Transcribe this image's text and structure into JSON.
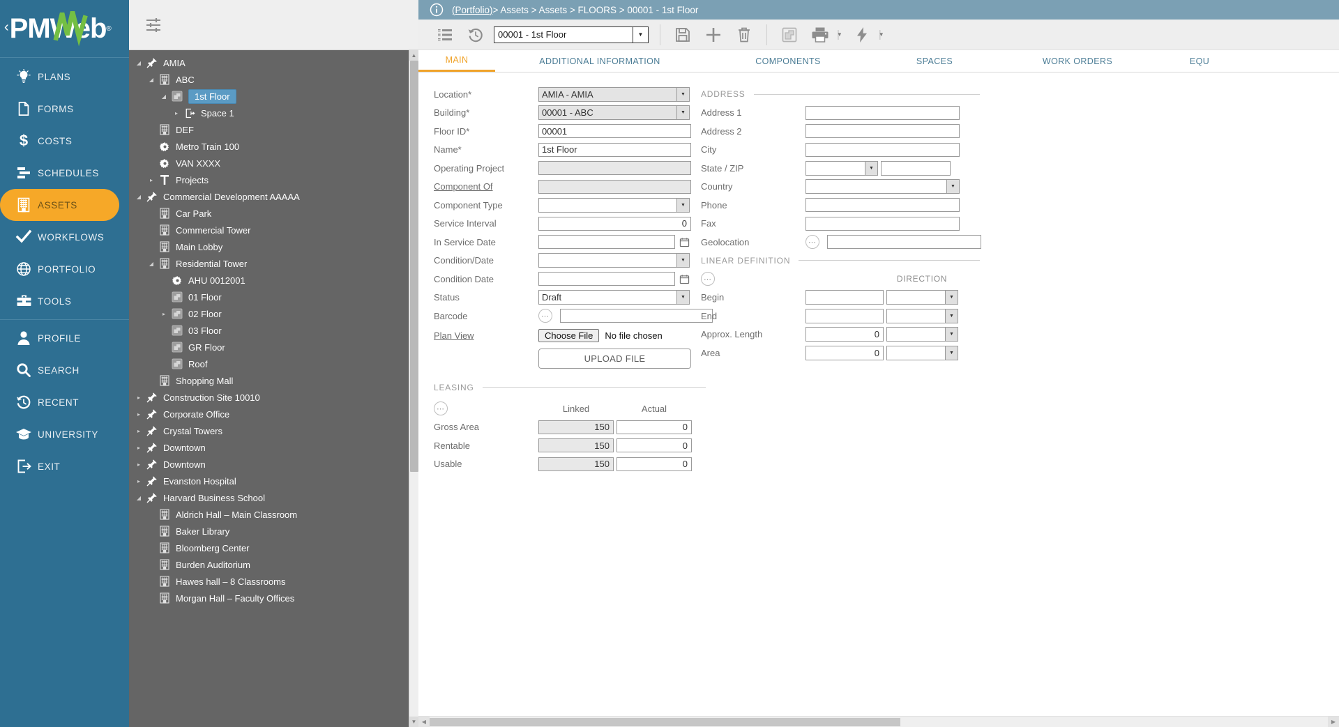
{
  "brand": {
    "logo_text": "PMWeb",
    "chevron": "‹",
    "registered": "®",
    "accent_color": "#f6a828",
    "nav_bg": "#2e6f92"
  },
  "sidebar": {
    "items": [
      {
        "label": "PLANS",
        "icon": "lightbulb-icon",
        "active": false
      },
      {
        "label": "FORMS",
        "icon": "document-icon",
        "active": false
      },
      {
        "label": "COSTS",
        "icon": "dollar-icon",
        "active": false
      },
      {
        "label": "SCHEDULES",
        "icon": "gantt-icon",
        "active": false
      },
      {
        "label": "ASSETS",
        "icon": "building-icon",
        "active": true
      },
      {
        "label": "WORKFLOWS",
        "icon": "check-icon",
        "active": false
      },
      {
        "label": "PORTFOLIO",
        "icon": "globe-icon",
        "active": false
      },
      {
        "label": "TOOLS",
        "icon": "toolbox-icon",
        "active": false
      }
    ],
    "items2": [
      {
        "label": "PROFILE",
        "icon": "user-icon"
      },
      {
        "label": "SEARCH",
        "icon": "magnifier-icon"
      },
      {
        "label": "RECENT",
        "icon": "history-icon"
      },
      {
        "label": "UNIVERSITY",
        "icon": "graduation-icon"
      },
      {
        "label": "EXIT",
        "icon": "exit-icon"
      }
    ]
  },
  "breadcrumb": {
    "info_icon": "info-icon",
    "portfolio": "(Portfolio)",
    "trail": " > Assets > Assets > FLOORS > 00001 - 1st Floor"
  },
  "toolbar": {
    "list_icon": "list-icon",
    "history_icon": "history-icon",
    "record_value": "00001 - 1st Floor",
    "save_icon": "save-icon",
    "add_icon": "plus-icon",
    "delete_icon": "trash-icon",
    "plan_icon": "floorplan-icon",
    "print_icon": "print-icon",
    "actions_icon": "lightning-icon"
  },
  "tree": {
    "filter_icon": "filter-icon",
    "nodes": [
      {
        "label": "AMIA",
        "indent": 0,
        "icon": "pin-icon",
        "twisty": "down",
        "selected": false
      },
      {
        "label": "ABC",
        "indent": 1,
        "icon": "building-icon",
        "twisty": "down",
        "selected": false
      },
      {
        "label": "1st Floor",
        "indent": 2,
        "icon": "floorplan-icon",
        "twisty": "down",
        "selected": true
      },
      {
        "label": "Space 1",
        "indent": 3,
        "icon": "space-icon",
        "twisty": "right",
        "selected": false
      },
      {
        "label": "DEF",
        "indent": 1,
        "icon": "building-icon",
        "twisty": "none",
        "selected": false
      },
      {
        "label": "Metro Train 100",
        "indent": 1,
        "icon": "gear-icon",
        "twisty": "none",
        "selected": false
      },
      {
        "label": "VAN XXXX",
        "indent": 1,
        "icon": "gear-icon",
        "twisty": "none",
        "selected": false
      },
      {
        "label": "Projects",
        "indent": 1,
        "icon": "tool-icon",
        "twisty": "right",
        "selected": false
      },
      {
        "label": "Commercial Development AAAAA",
        "indent": 0,
        "icon": "pin-icon",
        "twisty": "down",
        "selected": false
      },
      {
        "label": "Car Park",
        "indent": 1,
        "icon": "building-icon",
        "twisty": "none",
        "selected": false
      },
      {
        "label": "Commercial Tower",
        "indent": 1,
        "icon": "building-icon",
        "twisty": "none",
        "selected": false
      },
      {
        "label": "Main Lobby",
        "indent": 1,
        "icon": "building-icon",
        "twisty": "none",
        "selected": false
      },
      {
        "label": "Residential Tower",
        "indent": 1,
        "icon": "building-icon",
        "twisty": "down",
        "selected": false
      },
      {
        "label": "AHU 0012001",
        "indent": 2,
        "icon": "gear-icon",
        "twisty": "none",
        "selected": false
      },
      {
        "label": "01 Floor",
        "indent": 2,
        "icon": "floorplan-icon",
        "twisty": "none",
        "selected": false
      },
      {
        "label": "02 Floor",
        "indent": 2,
        "icon": "floorplan-icon",
        "twisty": "right",
        "selected": false
      },
      {
        "label": "03 Floor",
        "indent": 2,
        "icon": "floorplan-icon",
        "twisty": "none",
        "selected": false
      },
      {
        "label": "GR Floor",
        "indent": 2,
        "icon": "floorplan-icon",
        "twisty": "none",
        "selected": false
      },
      {
        "label": "Roof",
        "indent": 2,
        "icon": "floorplan-icon",
        "twisty": "none",
        "selected": false
      },
      {
        "label": "Shopping Mall",
        "indent": 1,
        "icon": "building-icon",
        "twisty": "none",
        "selected": false
      },
      {
        "label": "Construction Site 10010",
        "indent": 0,
        "icon": "pin-icon",
        "twisty": "right",
        "selected": false
      },
      {
        "label": "Corporate Office",
        "indent": 0,
        "icon": "pin-icon",
        "twisty": "right",
        "selected": false
      },
      {
        "label": "Crystal Towers",
        "indent": 0,
        "icon": "pin-icon",
        "twisty": "right",
        "selected": false
      },
      {
        "label": "Downtown",
        "indent": 0,
        "icon": "pin-icon",
        "twisty": "right",
        "selected": false
      },
      {
        "label": "Downtown",
        "indent": 0,
        "icon": "pin-icon",
        "twisty": "right",
        "selected": false
      },
      {
        "label": "Evanston Hospital",
        "indent": 0,
        "icon": "pin-icon",
        "twisty": "right",
        "selected": false
      },
      {
        "label": "Harvard Business School",
        "indent": 0,
        "icon": "pin-icon",
        "twisty": "down",
        "selected": false
      },
      {
        "label": "Aldrich Hall – Main Classroom",
        "indent": 1,
        "icon": "building-icon",
        "twisty": "none",
        "selected": false
      },
      {
        "label": "Baker Library",
        "indent": 1,
        "icon": "building-icon",
        "twisty": "none",
        "selected": false
      },
      {
        "label": "Bloomberg Center",
        "indent": 1,
        "icon": "building-icon",
        "twisty": "none",
        "selected": false
      },
      {
        "label": "Burden Auditorium",
        "indent": 1,
        "icon": "building-icon",
        "twisty": "none",
        "selected": false
      },
      {
        "label": "Hawes hall – 8 Classrooms",
        "indent": 1,
        "icon": "building-icon",
        "twisty": "none",
        "selected": false
      },
      {
        "label": "Morgan Hall – Faculty Offices",
        "indent": 1,
        "icon": "building-icon",
        "twisty": "none",
        "selected": false
      }
    ]
  },
  "tabs": [
    {
      "label": "MAIN",
      "active": true
    },
    {
      "label": "ADDITIONAL INFORMATION",
      "active": false
    },
    {
      "label": "COMPONENTS",
      "active": false
    },
    {
      "label": "SPACES",
      "active": false
    },
    {
      "label": "WORK ORDERS",
      "active": false
    },
    {
      "label": "EQU",
      "active": false
    }
  ],
  "form": {
    "left_fields": [
      {
        "label": "Location*",
        "type": "select",
        "value": "AMIA - AMIA",
        "gray": true
      },
      {
        "label": "Building*",
        "type": "select",
        "value": "00001 - ABC",
        "gray": true
      },
      {
        "label": "Floor ID*",
        "type": "text",
        "value": "00001",
        "gray": false
      },
      {
        "label": "Name*",
        "type": "text",
        "value": "1st Floor",
        "gray": false
      },
      {
        "label": "Operating Project",
        "type": "text",
        "value": "",
        "gray": true
      },
      {
        "label": "Component Of",
        "type": "text",
        "value": "",
        "gray": true,
        "link": true
      },
      {
        "label": "Component Type",
        "type": "select",
        "value": "",
        "gray": false
      },
      {
        "label": "Service Interval",
        "type": "number",
        "value": "0",
        "gray": false
      },
      {
        "label": "In Service Date",
        "type": "date",
        "value": "",
        "gray": false
      },
      {
        "label": "Condition/Date",
        "type": "select",
        "value": "",
        "gray": false
      },
      {
        "label": "Condition Date",
        "type": "date",
        "value": "",
        "gray": false
      },
      {
        "label": "Status",
        "type": "select",
        "value": "Draft",
        "gray": false
      },
      {
        "label": "Barcode",
        "type": "text-ellipsis",
        "value": "",
        "gray": false
      },
      {
        "label": "Plan View",
        "type": "file",
        "value": "",
        "gray": false,
        "link": true
      }
    ],
    "file_button_label": "Choose File",
    "file_name_label": "No file chosen",
    "upload_label": "UPLOAD FILE",
    "leasing": {
      "section_label": "LEASING",
      "col_linked": "Linked",
      "col_actual": "Actual",
      "rows": [
        {
          "label": "Gross Area",
          "linked": "150",
          "actual": "0"
        },
        {
          "label": "Rentable",
          "linked": "150",
          "actual": "0"
        },
        {
          "label": "Usable",
          "linked": "150",
          "actual": "0"
        }
      ]
    },
    "address": {
      "section_label": "ADDRESS",
      "fields": [
        {
          "label": "Address 1",
          "type": "text",
          "value": ""
        },
        {
          "label": "Address 2",
          "type": "text",
          "value": ""
        },
        {
          "label": "City",
          "type": "text",
          "value": ""
        },
        {
          "label": "State / ZIP",
          "type": "select-plus-text",
          "value": ""
        },
        {
          "label": "Country",
          "type": "select-wide",
          "value": ""
        },
        {
          "label": "Phone",
          "type": "text",
          "value": ""
        },
        {
          "label": "Fax",
          "type": "text",
          "value": ""
        },
        {
          "label": "Geolocation",
          "type": "text-ellipsis",
          "value": ""
        }
      ]
    },
    "linear": {
      "section_label": "LINEAR DEFINITION",
      "direction_label": "DIRECTION",
      "rows": [
        {
          "label": "Begin",
          "value": "",
          "unit": ""
        },
        {
          "label": "End",
          "value": "",
          "unit": ""
        },
        {
          "label": "Approx. Length",
          "value": "0",
          "unit": ""
        },
        {
          "label": "Area",
          "value": "0",
          "unit": ""
        }
      ]
    }
  }
}
